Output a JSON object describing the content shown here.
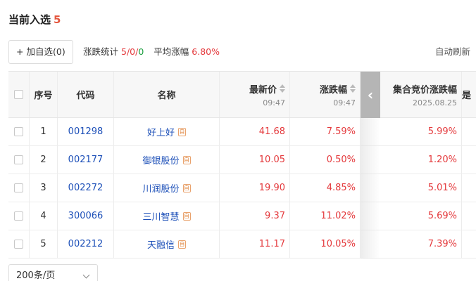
{
  "header": {
    "title": "当前入选",
    "count": "5"
  },
  "toolbar": {
    "add_label": "加自选(0)",
    "stats_label": "涨跌统计",
    "stats_up": "5",
    "stats_sep1": "/",
    "stats_flat": "0",
    "stats_sep2": "/",
    "stats_down": "0",
    "avg_label": "平均涨幅",
    "avg_value": "6.80%",
    "auto_refresh": "自动刷新"
  },
  "table": {
    "columns": {
      "no": "序号",
      "code": "代码",
      "name": "名称",
      "price": "最新价",
      "price_time": "09:47",
      "change": "涨跌幅",
      "change_time": "09:47",
      "auction": "集合竞价涨跌幅",
      "auction_date": "2025.08.25",
      "more": "是"
    },
    "self_tag": "自",
    "rows": [
      {
        "no": "1",
        "code": "001298",
        "name": "好上好",
        "price": "41.68",
        "change": "7.59%",
        "auction": "5.99%"
      },
      {
        "no": "2",
        "code": "002177",
        "name": "御银股份",
        "price": "10.05",
        "change": "0.50%",
        "auction": "1.20%"
      },
      {
        "no": "3",
        "code": "002272",
        "name": "川润股份",
        "price": "19.90",
        "change": "4.85%",
        "auction": "5.01%"
      },
      {
        "no": "4",
        "code": "300066",
        "name": "三川智慧",
        "price": "9.37",
        "change": "11.02%",
        "auction": "5.69%"
      },
      {
        "no": "5",
        "code": "002212",
        "name": "天融信",
        "price": "11.17",
        "change": "10.05%",
        "auction": "7.39%"
      }
    ]
  },
  "pager": {
    "page_size": "200条/页"
  },
  "colors": {
    "up": "#e4393c",
    "flat": "#1a9e3e",
    "link": "#1c4fb8",
    "count_accent": "#e4573f"
  }
}
